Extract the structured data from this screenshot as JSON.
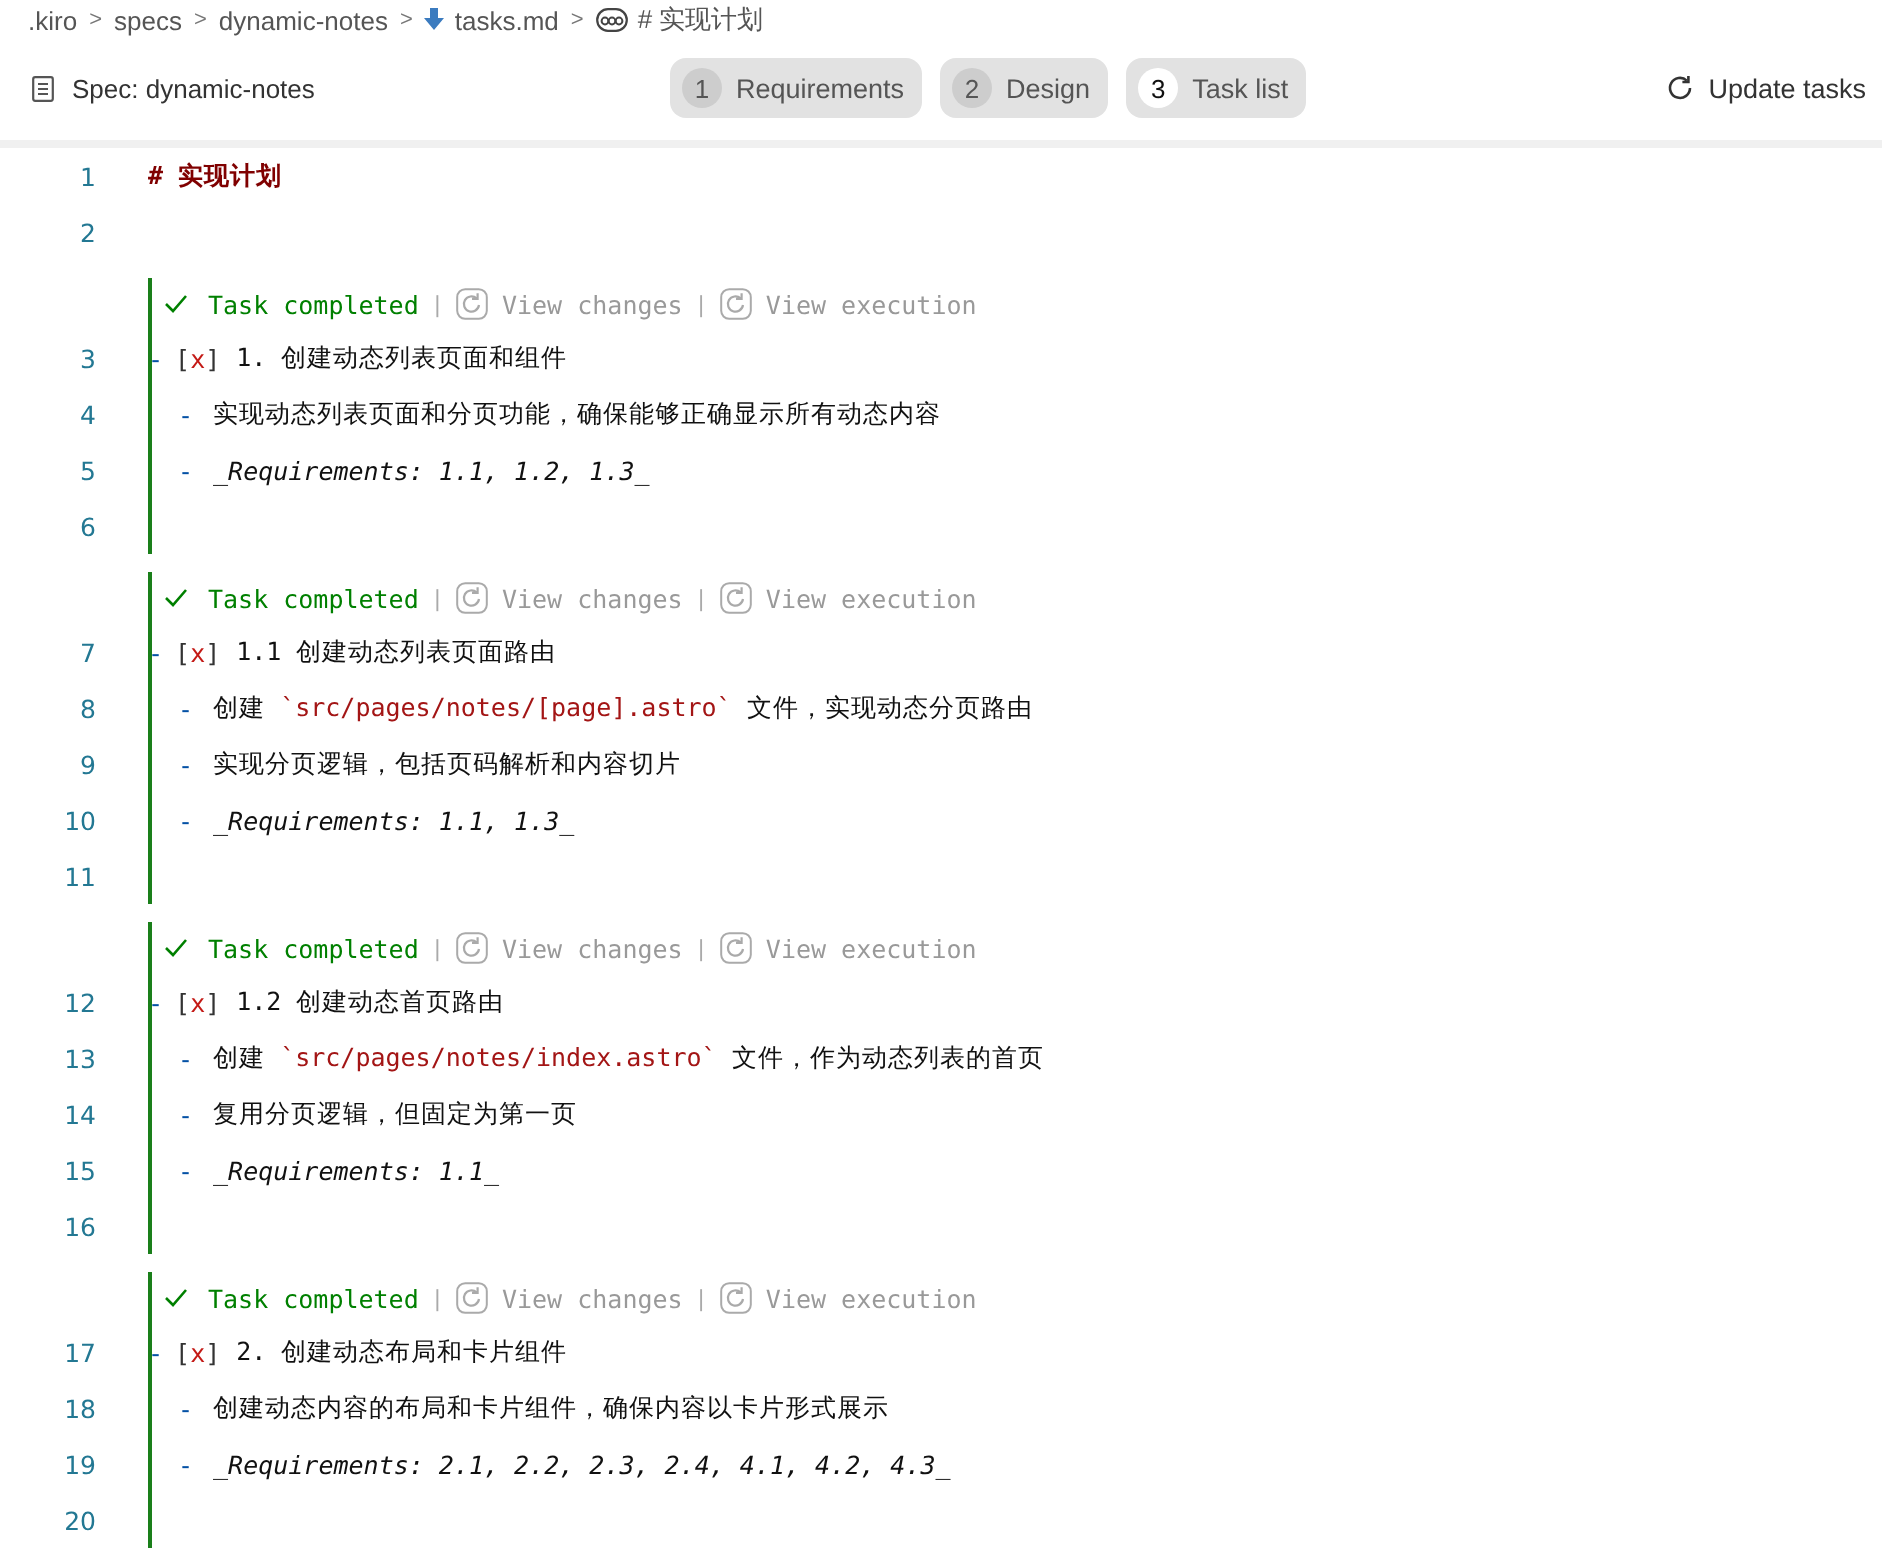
{
  "breadcrumb": [
    {
      "kind": "folder",
      "label": ".kiro",
      "separator": ">"
    },
    {
      "kind": "folder",
      "label": "specs",
      "separator": ">"
    },
    {
      "kind": "folder",
      "label": "dynamic-notes",
      "separator": ">"
    },
    {
      "kind": "file",
      "label": "tasks.md",
      "separator": ">"
    },
    {
      "kind": "symbol",
      "label": "# 实现计划"
    }
  ],
  "toolbar": {
    "spec_label": "Spec: dynamic-notes",
    "steps": [
      {
        "number": "1",
        "label": "Requirements",
        "selected": false
      },
      {
        "number": "2",
        "label": "Design",
        "selected": false
      },
      {
        "number": "3",
        "label": "Task list",
        "selected": true
      }
    ],
    "update_button": "Update tasks"
  },
  "editor": {
    "lines": [
      {
        "number": "1",
        "kind": "heading",
        "text": "# 实现计划"
      },
      {
        "number": "2",
        "kind": "blank"
      }
    ],
    "tasks": [
      {
        "status": "Task completed",
        "separator": "|",
        "actions": [
          "View changes",
          "View execution"
        ],
        "lines": [
          {
            "number": "3",
            "kind": "task",
            "marker": "-",
            "checkbox": [
              "[",
              "x",
              "]"
            ],
            "checked": true,
            "text": "1. 创建动态列表页面和组件"
          },
          {
            "number": "4",
            "kind": "bullet",
            "marker": "-",
            "segments": [
              {
                "kind": "text",
                "text": "实现动态列表页面和分页功能，确保能够正确显示所有动态内容"
              }
            ]
          },
          {
            "number": "5",
            "kind": "bullet",
            "marker": "-",
            "segments": [
              {
                "kind": "emphasis",
                "text": "_Requirements: 1.1, 1.2, 1.3_"
              }
            ]
          },
          {
            "number": "6",
            "kind": "blank"
          }
        ]
      },
      {
        "status": "Task completed",
        "separator": "|",
        "actions": [
          "View changes",
          "View execution"
        ],
        "lines": [
          {
            "number": "7",
            "kind": "task",
            "marker": "-",
            "checkbox": [
              "[",
              "x",
              "]"
            ],
            "checked": true,
            "text": "1.1 创建动态列表页面路由"
          },
          {
            "number": "8",
            "kind": "bullet",
            "marker": "-",
            "segments": [
              {
                "kind": "text",
                "text": "创建 "
              },
              {
                "kind": "code",
                "text": "`src/pages/notes/[page].astro`"
              },
              {
                "kind": "text",
                "text": " 文件，实现动态分页路由"
              }
            ]
          },
          {
            "number": "9",
            "kind": "bullet",
            "marker": "-",
            "segments": [
              {
                "kind": "text",
                "text": "实现分页逻辑，包括页码解析和内容切片"
              }
            ]
          },
          {
            "number": "10",
            "kind": "bullet",
            "marker": "-",
            "segments": [
              {
                "kind": "emphasis",
                "text": "_Requirements: 1.1, 1.3_"
              }
            ]
          },
          {
            "number": "11",
            "kind": "blank"
          }
        ]
      },
      {
        "status": "Task completed",
        "separator": "|",
        "actions": [
          "View changes",
          "View execution"
        ],
        "lines": [
          {
            "number": "12",
            "kind": "task",
            "marker": "-",
            "checkbox": [
              "[",
              "x",
              "]"
            ],
            "checked": true,
            "text": "1.2 创建动态首页路由"
          },
          {
            "number": "13",
            "kind": "bullet",
            "marker": "-",
            "segments": [
              {
                "kind": "text",
                "text": "创建 "
              },
              {
                "kind": "code",
                "text": "`src/pages/notes/index.astro`"
              },
              {
                "kind": "text",
                "text": " 文件，作为动态列表的首页"
              }
            ]
          },
          {
            "number": "14",
            "kind": "bullet",
            "marker": "-",
            "segments": [
              {
                "kind": "text",
                "text": "复用分页逻辑，但固定为第一页"
              }
            ]
          },
          {
            "number": "15",
            "kind": "bullet",
            "marker": "-",
            "segments": [
              {
                "kind": "emphasis",
                "text": "_Requirements: 1.1_"
              }
            ]
          },
          {
            "number": "16",
            "kind": "blank"
          }
        ]
      },
      {
        "status": "Task completed",
        "separator": "|",
        "actions": [
          "View changes",
          "View execution"
        ],
        "lines": [
          {
            "number": "17",
            "kind": "task",
            "marker": "-",
            "checkbox": [
              "[",
              "x",
              "]"
            ],
            "checked": true,
            "text": "2. 创建动态布局和卡片组件"
          },
          {
            "number": "18",
            "kind": "bullet",
            "marker": "-",
            "segments": [
              {
                "kind": "text",
                "text": "创建动态内容的布局和卡片组件，确保内容以卡片形式展示"
              }
            ]
          },
          {
            "number": "19",
            "kind": "bullet",
            "marker": "-",
            "segments": [
              {
                "kind": "emphasis",
                "text": "_Requirements: 2.1, 2.2, 2.3, 2.4, 4.1, 4.2, 4.3_"
              }
            ]
          },
          {
            "number": "20",
            "kind": "blank"
          }
        ]
      }
    ]
  }
}
